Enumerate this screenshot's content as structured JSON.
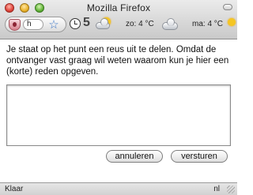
{
  "window": {
    "title": "Mozilla Firefox"
  },
  "toolbar": {
    "field_value": "h",
    "current_temp": "5",
    "forecast": [
      {
        "label": "zo: 4 °C",
        "icon": "cloud-icon"
      },
      {
        "label": "ma: 4 °C",
        "icon": "sun-cloud-icon"
      }
    ],
    "current_icon": "sun-cloud-icon"
  },
  "dialog": {
    "prompt": "Je staat op het punt een reus uit te delen. Omdat de ontvanger vast graag wil weten waarom kun je hier een (korte) reden opgeven.",
    "reason_value": "",
    "cancel_label": "annuleren",
    "send_label": "versturen"
  },
  "statusbar": {
    "status": "Klaar",
    "language": "nl"
  },
  "colors": {
    "sun": "#f5c623",
    "star": "#3f78c8",
    "shield": "#d7808c"
  }
}
